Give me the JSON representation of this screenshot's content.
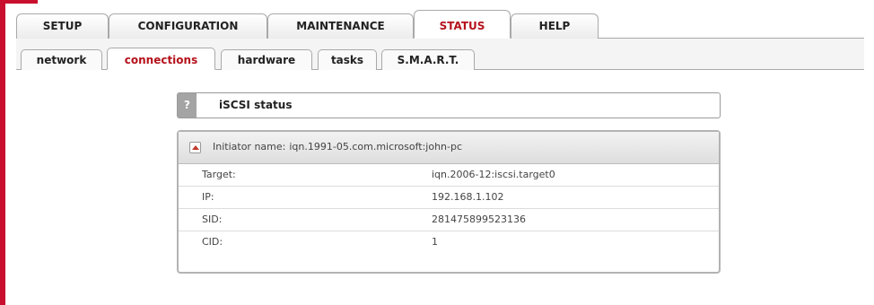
{
  "main_tabs": [
    {
      "label": "SETUP",
      "active": false
    },
    {
      "label": "CONFIGURATION",
      "active": false
    },
    {
      "label": "MAINTENANCE",
      "active": false
    },
    {
      "label": "STATUS",
      "active": true
    },
    {
      "label": "HELP",
      "active": false
    }
  ],
  "sub_tabs": [
    {
      "label": "network",
      "active": false
    },
    {
      "label": "connections",
      "active": true
    },
    {
      "label": "hardware",
      "active": false
    },
    {
      "label": "tasks",
      "active": false
    },
    {
      "label": "S.M.A.R.T.",
      "active": false
    }
  ],
  "status_header": {
    "help_icon": "?",
    "title": "iSCSI status"
  },
  "initiator": {
    "label": "Initiator name:",
    "value": "iqn.1991-05.com.microsoft:john-pc",
    "collapse_icon": "chevron-up-icon"
  },
  "rows": [
    {
      "key": "Target:",
      "value": "iqn.2006-12:iscsi.target0"
    },
    {
      "key": "IP:",
      "value": "192.168.1.102"
    },
    {
      "key": "SID:",
      "value": "281475899523136"
    },
    {
      "key": "CID:",
      "value": "1"
    }
  ],
  "colors": {
    "accent": "#b5121b",
    "frame": "#c8102e"
  }
}
